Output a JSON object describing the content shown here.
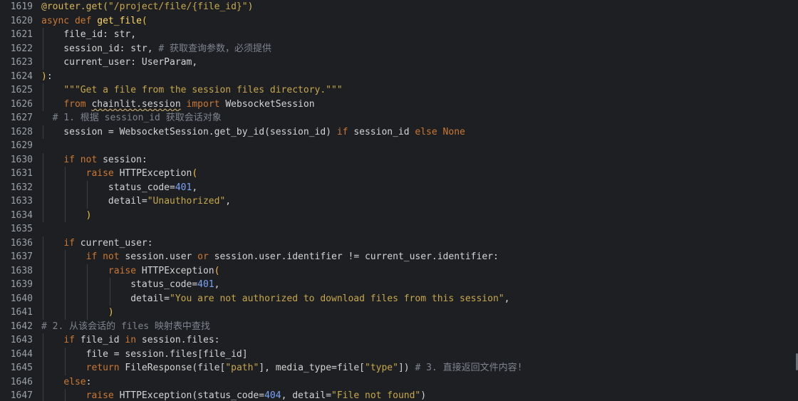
{
  "editor": {
    "lines": [
      {
        "n": "1619",
        "tokens": [
          [
            "decorator",
            "@router.get("
          ],
          [
            "string",
            "\"/project/file/{file_id}\""
          ],
          [
            "decorator",
            ")"
          ]
        ]
      },
      {
        "n": "1620",
        "tokens": [
          [
            "keyword",
            "async def "
          ],
          [
            "function",
            "get_file"
          ],
          [
            "paren",
            "("
          ]
        ]
      },
      {
        "n": "1621",
        "tokens": [
          [
            "default",
            "    file_id: str,"
          ]
        ]
      },
      {
        "n": "1622",
        "tokens": [
          [
            "default",
            "    session_id: str, "
          ],
          [
            "comment",
            "# 获取查询参数，必须提供"
          ]
        ]
      },
      {
        "n": "1623",
        "tokens": [
          [
            "default",
            "    current_user: UserParam,"
          ]
        ]
      },
      {
        "n": "1624",
        "tokens": [
          [
            "paren",
            ")"
          ],
          [
            "default",
            ":"
          ]
        ]
      },
      {
        "n": "1625",
        "tokens": [
          [
            "default",
            "    "
          ],
          [
            "string",
            "\"\"\"Get a file from the session files directory.\"\"\""
          ]
        ]
      },
      {
        "n": "1626",
        "tokens": [
          [
            "default",
            "    "
          ],
          [
            "keyword",
            "from "
          ],
          [
            "underline",
            "chainlit.session"
          ],
          [
            "default",
            " "
          ],
          [
            "keyword",
            "import "
          ],
          [
            "default",
            "WebsocketSession"
          ]
        ]
      },
      {
        "n": "1627",
        "tokens": [
          [
            "comment",
            "  # 1. 根据 session_id 获取会话对象"
          ]
        ]
      },
      {
        "n": "1628",
        "tokens": [
          [
            "default",
            "    session = WebsocketSession.get_by_id(session_id) "
          ],
          [
            "keyword",
            "if "
          ],
          [
            "default",
            "session_id "
          ],
          [
            "keyword",
            "else "
          ],
          [
            "keyword",
            "None"
          ]
        ]
      },
      {
        "n": "1629",
        "tokens": []
      },
      {
        "n": "1630",
        "tokens": [
          [
            "default",
            "    "
          ],
          [
            "keyword",
            "if not "
          ],
          [
            "default",
            "session:"
          ]
        ]
      },
      {
        "n": "1631",
        "tokens": [
          [
            "default",
            "        "
          ],
          [
            "keyword",
            "raise "
          ],
          [
            "default",
            "HTTPException"
          ],
          [
            "paren",
            "("
          ]
        ]
      },
      {
        "n": "1632",
        "tokens": [
          [
            "default",
            "            status_code="
          ],
          [
            "number",
            "401"
          ],
          [
            "default",
            ","
          ]
        ]
      },
      {
        "n": "1633",
        "tokens": [
          [
            "default",
            "            detail="
          ],
          [
            "string",
            "\"Unauthorized\""
          ],
          [
            "default",
            ","
          ]
        ]
      },
      {
        "n": "1634",
        "tokens": [
          [
            "default",
            "        "
          ],
          [
            "paren",
            ")"
          ]
        ]
      },
      {
        "n": "1635",
        "tokens": []
      },
      {
        "n": "1636",
        "tokens": [
          [
            "default",
            "    "
          ],
          [
            "keyword",
            "if "
          ],
          [
            "default",
            "current_user:"
          ]
        ]
      },
      {
        "n": "1637",
        "tokens": [
          [
            "default",
            "        "
          ],
          [
            "keyword",
            "if not "
          ],
          [
            "default",
            "session.user "
          ],
          [
            "keyword",
            "or "
          ],
          [
            "default",
            "session.user.identifier != current_user.identifier:"
          ]
        ]
      },
      {
        "n": "1638",
        "tokens": [
          [
            "default",
            "            "
          ],
          [
            "keyword",
            "raise "
          ],
          [
            "default",
            "HTTPException"
          ],
          [
            "paren",
            "("
          ]
        ]
      },
      {
        "n": "1639",
        "tokens": [
          [
            "default",
            "                status_code="
          ],
          [
            "number",
            "401"
          ],
          [
            "default",
            ","
          ]
        ]
      },
      {
        "n": "1640",
        "tokens": [
          [
            "default",
            "                detail="
          ],
          [
            "string",
            "\"You are not authorized to download files from this session\""
          ],
          [
            "default",
            ","
          ]
        ]
      },
      {
        "n": "1641",
        "tokens": [
          [
            "default",
            "            "
          ],
          [
            "paren",
            ")"
          ]
        ]
      },
      {
        "n": "1642",
        "tokens": [
          [
            "comment",
            "# 2. 从该会话的 files 映射表中查找"
          ]
        ]
      },
      {
        "n": "1643",
        "tokens": [
          [
            "default",
            "    "
          ],
          [
            "keyword",
            "if "
          ],
          [
            "default",
            "file_id "
          ],
          [
            "keyword",
            "in "
          ],
          [
            "default",
            "session.files:"
          ]
        ]
      },
      {
        "n": "1644",
        "tokens": [
          [
            "default",
            "        file = session.files[file_id]"
          ]
        ]
      },
      {
        "n": "1645",
        "tokens": [
          [
            "default",
            "        "
          ],
          [
            "keyword",
            "return "
          ],
          [
            "default",
            "FileResponse(file["
          ],
          [
            "string",
            "\"path\""
          ],
          [
            "default",
            "], media_type=file["
          ],
          [
            "string",
            "\"type\""
          ],
          [
            "default",
            "]) "
          ],
          [
            "comment",
            "# 3. 直接返回文件内容!"
          ]
        ]
      },
      {
        "n": "1646",
        "tokens": [
          [
            "default",
            "    "
          ],
          [
            "keyword",
            "else"
          ],
          [
            "default",
            ":"
          ]
        ]
      },
      {
        "n": "1647",
        "tokens": [
          [
            "default",
            "        "
          ],
          [
            "keyword",
            "raise "
          ],
          [
            "default",
            "HTTPException(status_code="
          ],
          [
            "number",
            "404"
          ],
          [
            "default",
            ", detail="
          ],
          [
            "string",
            "\"File not found\""
          ],
          [
            "default",
            ")"
          ]
        ]
      }
    ]
  },
  "colors": {
    "background": "#1e1f22",
    "line_number": "#9aa0a6",
    "keyword": "#cc7832",
    "string": "#c7a84a",
    "comment": "#7f848e",
    "number": "#7aa2f7",
    "function": "#ffd866",
    "text": "#d4d4d4"
  }
}
